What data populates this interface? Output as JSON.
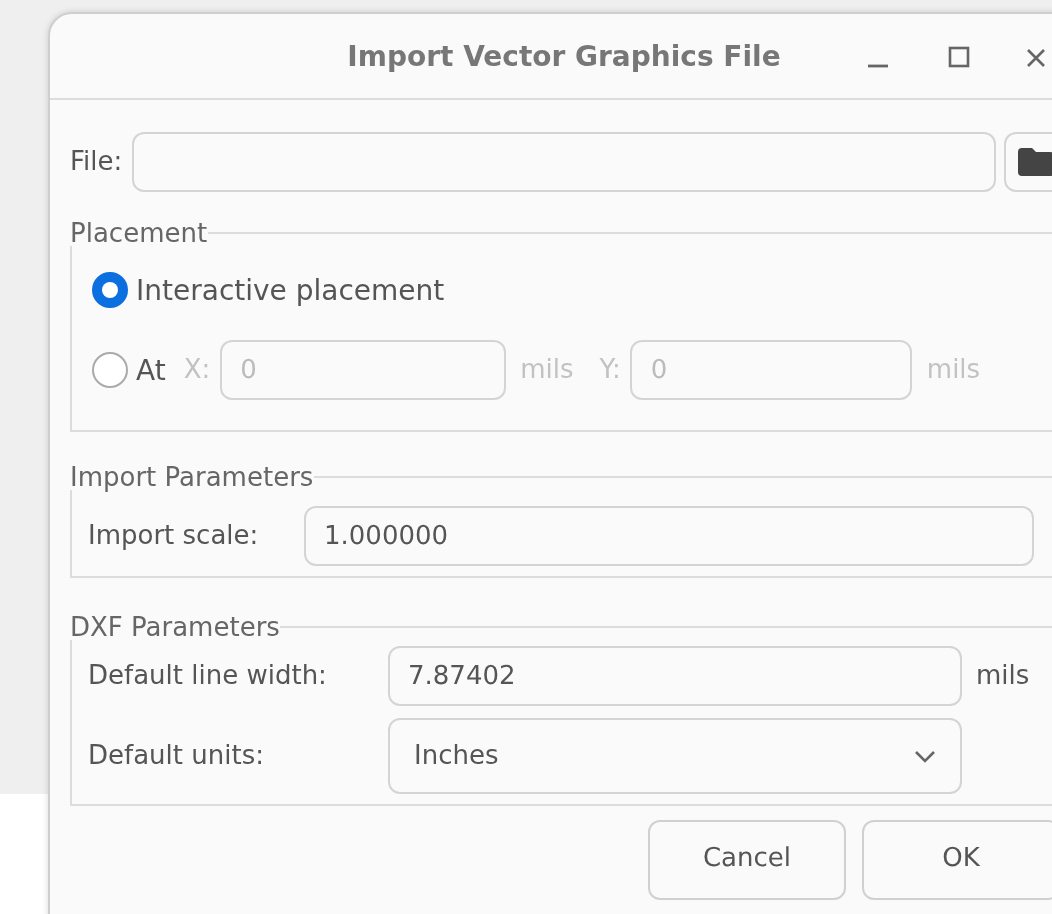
{
  "window": {
    "title": "Import Vector Graphics File"
  },
  "file": {
    "label": "File:"
  },
  "placement": {
    "title": "Placement",
    "options": [
      {
        "label": "Interactive placement",
        "selected": true
      },
      {
        "label": "At",
        "selected": false
      }
    ],
    "x": {
      "label": "X:",
      "value": "0",
      "unit": "mils",
      "disabled": true
    },
    "y": {
      "label": "Y:",
      "value": "0",
      "unit": "mils",
      "disabled": true
    }
  },
  "import_parameters": {
    "title": "Import Parameters",
    "scale": {
      "label": "Import scale:",
      "value": "1.000000"
    }
  },
  "dxf_parameters": {
    "title": "DXF Parameters",
    "line_width": {
      "label": "Default line width:",
      "value": "7.87402",
      "unit": "mils"
    },
    "units": {
      "label": "Default units:",
      "value": "Inches"
    }
  },
  "buttons": [
    "Cancel",
    "OK"
  ]
}
